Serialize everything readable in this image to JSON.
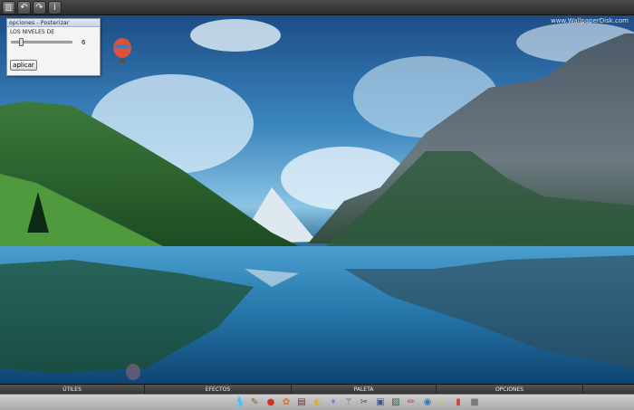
{
  "toolbar": {
    "buttons": [
      {
        "name": "layers-icon",
        "glyph": "▥"
      },
      {
        "name": "undo-icon",
        "glyph": "↶"
      },
      {
        "name": "redo-icon",
        "glyph": "↷"
      },
      {
        "name": "info-icon",
        "glyph": "i"
      }
    ]
  },
  "canvas": {
    "watermark": "www.WallpaperDisk.com"
  },
  "panel": {
    "title": "opciones - Posterizar",
    "label": "LOS NIVELES DE",
    "slider_value": "6",
    "slider_level": 0.16,
    "apply_label": "aplicar"
  },
  "tabs": [
    {
      "label": "ÚTILES"
    },
    {
      "label": "EFECTOS"
    },
    {
      "label": "PALETA"
    },
    {
      "label": "OPCIONES"
    }
  ],
  "icons": [
    {
      "name": "drop-icon",
      "glyph": "💧",
      "color": "#5aa0d8"
    },
    {
      "name": "brush-icon",
      "glyph": "✎",
      "color": "#8a5a2a"
    },
    {
      "name": "record-icon",
      "glyph": "●",
      "color": "#d83020"
    },
    {
      "name": "palette-icon",
      "glyph": "✿",
      "color": "#e07020"
    },
    {
      "name": "film-icon",
      "glyph": "▤",
      "color": "#7a2a2a"
    },
    {
      "name": "bulb-icon",
      "glyph": "◐",
      "color": "#d8b030"
    },
    {
      "name": "star-icon",
      "glyph": "✦",
      "color": "#9a6ad0"
    },
    {
      "name": "magic-wand-icon",
      "glyph": "⚚",
      "color": "#555"
    },
    {
      "name": "hammer-icon",
      "glyph": "✂",
      "color": "#6a4a2a"
    },
    {
      "name": "monitor-icon",
      "glyph": "▣",
      "color": "#3a5a8a"
    },
    {
      "name": "image-icon",
      "glyph": "▨",
      "color": "#2a6a3a"
    },
    {
      "name": "pencil-icon",
      "glyph": "✏",
      "color": "#c04040"
    },
    {
      "name": "globe-icon",
      "glyph": "◉",
      "color": "#2a7ac0"
    },
    {
      "name": "lightbulb-icon",
      "glyph": "☼",
      "color": "#e0c040"
    },
    {
      "name": "chart-icon",
      "glyph": "▮",
      "color": "#d84040"
    },
    {
      "name": "folder-icon",
      "glyph": "■",
      "color": "#7a7a7a"
    }
  ]
}
